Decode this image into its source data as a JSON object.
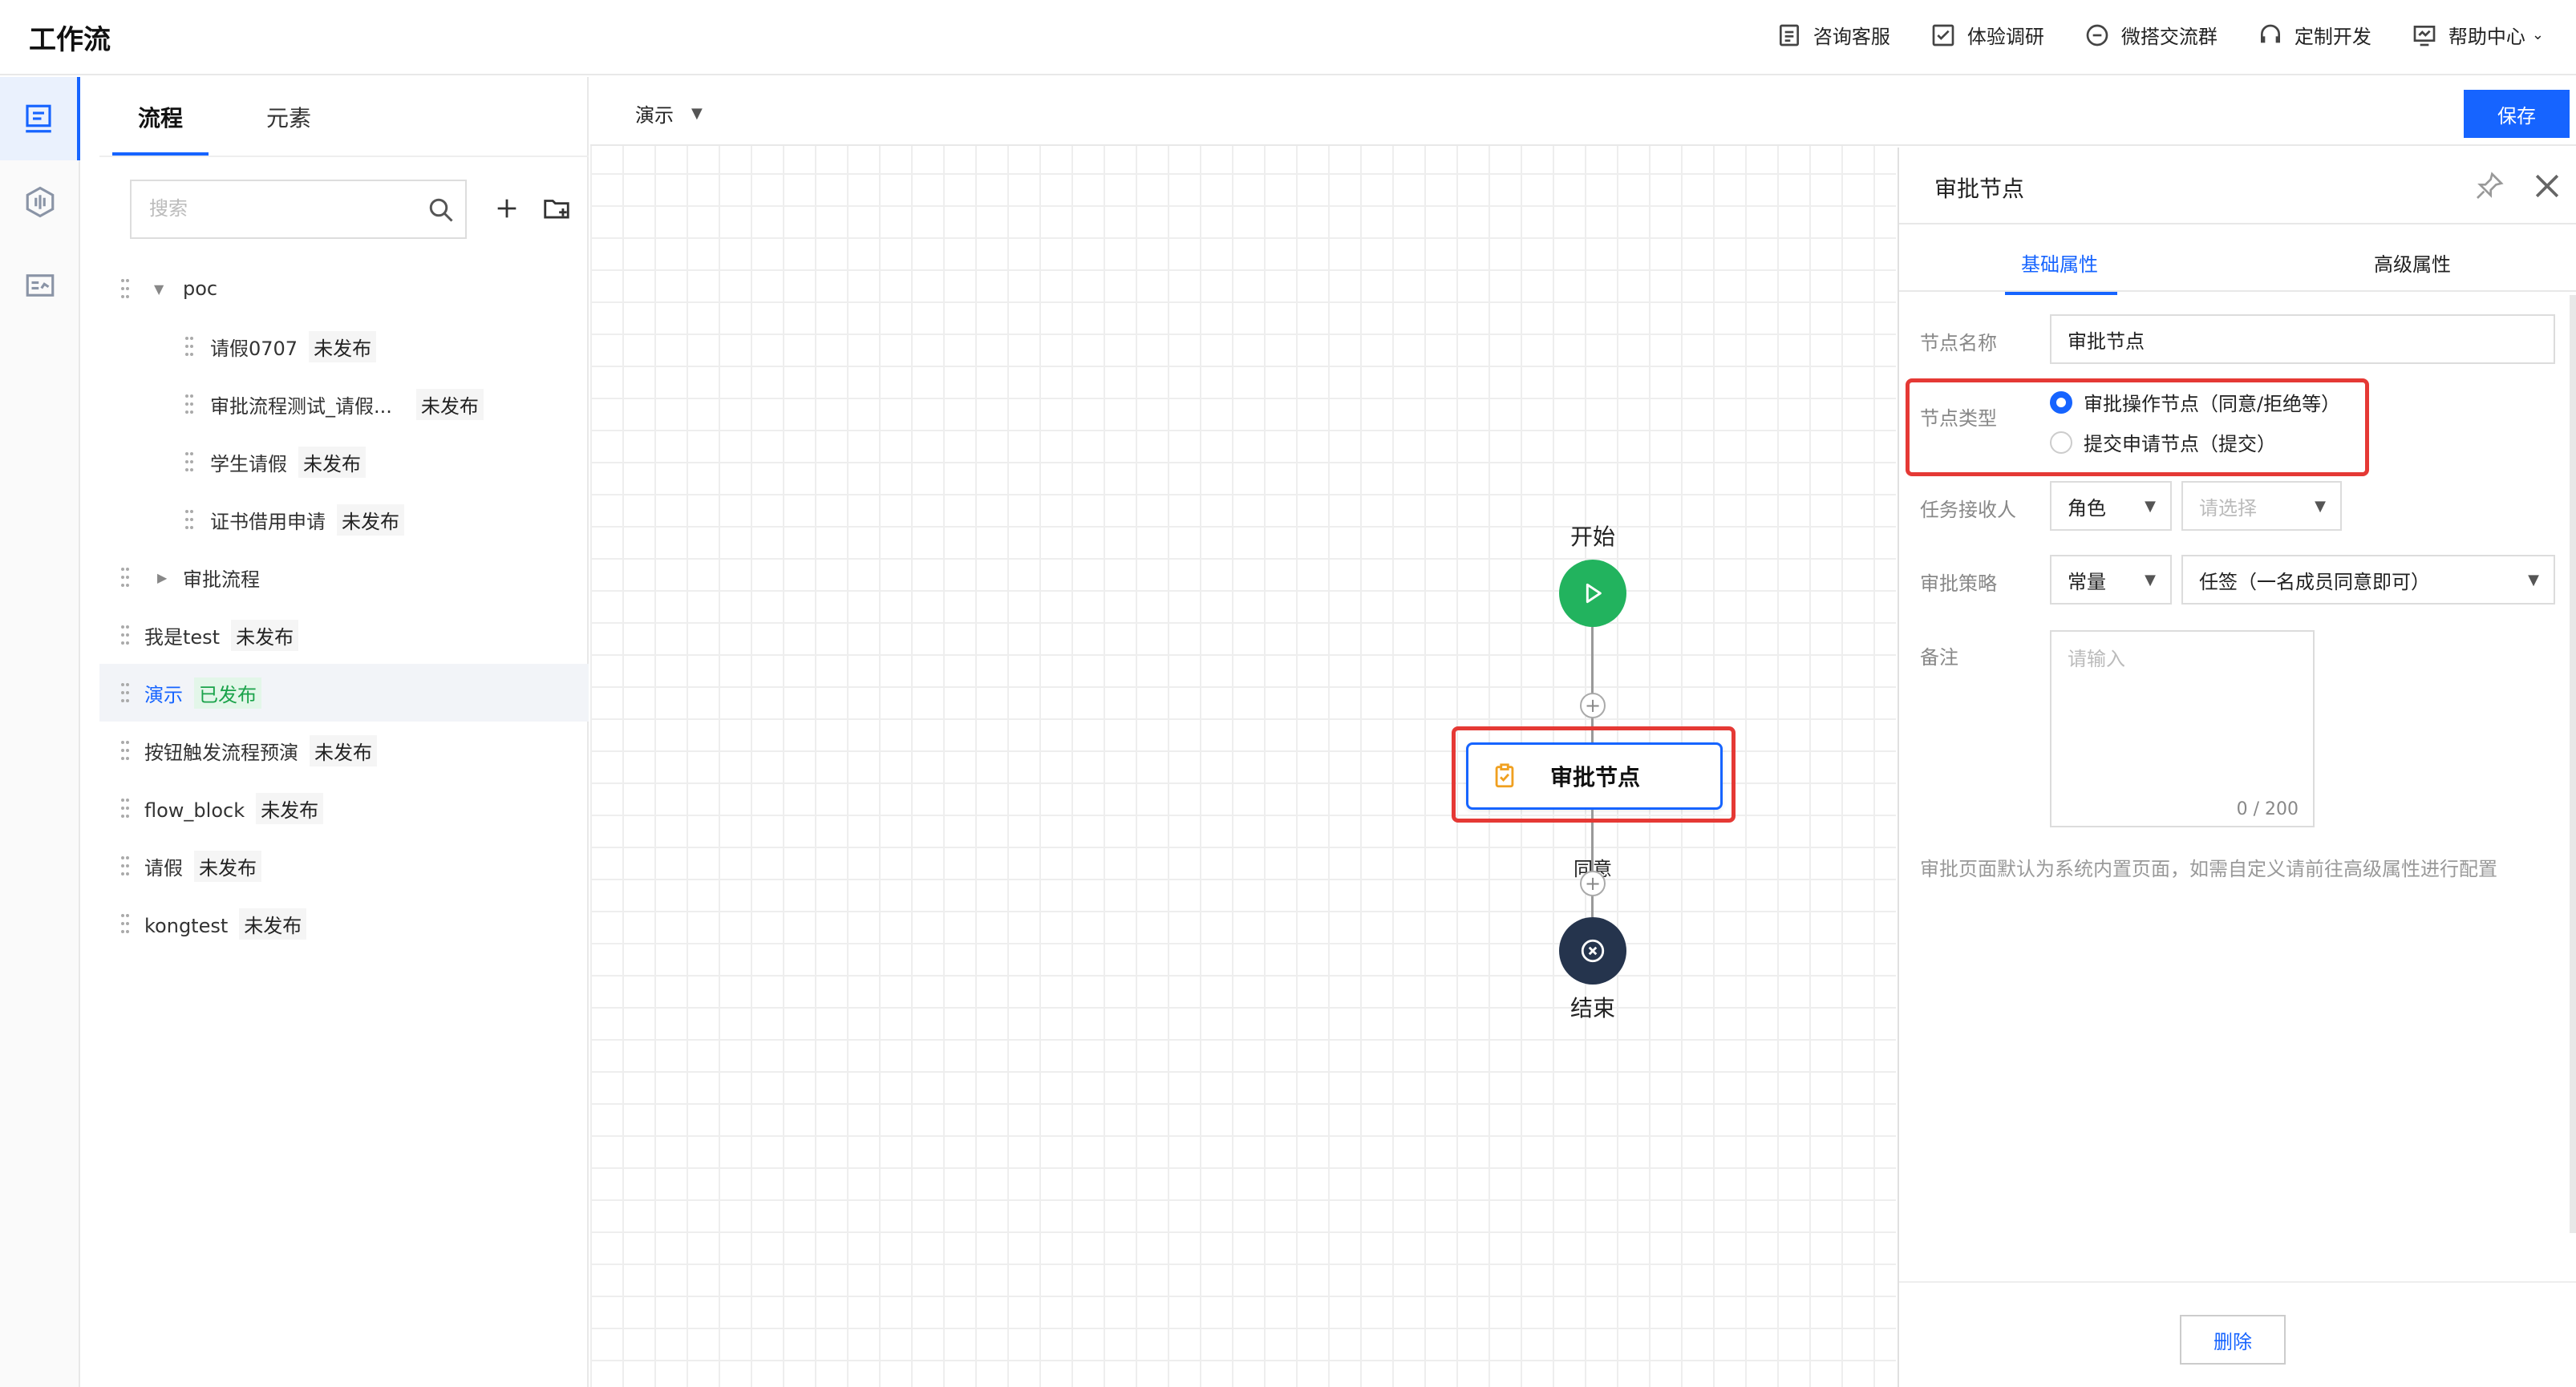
{
  "app": {
    "title": "工作流"
  },
  "top_nav": [
    {
      "label": "咨询客服",
      "icon": "clipboard-icon"
    },
    {
      "label": "体验调研",
      "icon": "checklist-icon"
    },
    {
      "label": "微搭交流群",
      "icon": "chat-icon"
    },
    {
      "label": "定制开发",
      "icon": "headset-icon"
    },
    {
      "label": "帮助中心",
      "icon": "monitor-help-icon"
    }
  ],
  "rail": [
    {
      "icon": "flow-doc-icon",
      "active": true
    },
    {
      "icon": "hexagon-icon",
      "active": false
    },
    {
      "icon": "form-icon",
      "active": false
    }
  ],
  "left_panel": {
    "tabs": [
      "流程",
      "元素"
    ],
    "active_tab": "流程",
    "search": {
      "placeholder": "搜索",
      "value": ""
    },
    "tree": [
      {
        "label": "poc",
        "level": 0,
        "type": "folder",
        "expanded": true,
        "badge": ""
      },
      {
        "label": "请假0707",
        "level": 1,
        "badge": "未发布"
      },
      {
        "label": "审批流程测试_请假...",
        "level": 1,
        "badge": "未发布"
      },
      {
        "label": "学生请假",
        "level": 1,
        "badge": "未发布"
      },
      {
        "label": "证书借用申请",
        "level": 1,
        "badge": "未发布"
      },
      {
        "label": "审批流程",
        "level": 0,
        "type": "folder",
        "expanded": false,
        "badge": ""
      },
      {
        "label": "我是test",
        "level": 0,
        "badge": "未发布"
      },
      {
        "label": "演示",
        "level": 0,
        "badge": "已发布",
        "selected": true
      },
      {
        "label": "按钮触发流程预演",
        "level": 0,
        "badge": "未发布"
      },
      {
        "label": "flow_block",
        "level": 0,
        "badge": "未发布"
      },
      {
        "label": "请假",
        "level": 0,
        "badge": "未发布"
      },
      {
        "label": "kongtest",
        "level": 0,
        "badge": "未发布"
      }
    ]
  },
  "canvas": {
    "flow_name": "演示",
    "save_label": "保存",
    "start_label": "开始",
    "approve_label": "审批节点",
    "edge_label": "同意",
    "end_label": "结束"
  },
  "props": {
    "title": "审批节点",
    "tabs": [
      "基础属性",
      "高级属性"
    ],
    "active_tab": "基础属性",
    "node_name_label": "节点名称",
    "node_name_value": "审批节点",
    "node_type_label": "节点类型",
    "node_type_options": [
      "审批操作节点（同意/拒绝等）",
      "提交申请节点（提交）"
    ],
    "node_type_selected": 0,
    "receiver_label": "任务接收人",
    "receiver_type": "角色",
    "receiver_placeholder": "请选择",
    "strategy_label": "审批策略",
    "strategy_type": "常量",
    "strategy_value": "任签（一名成员同意即可）",
    "remark_label": "备注",
    "remark_placeholder": "请输入",
    "remark_counter": "0 / 200",
    "hint": "审批页面默认为系统内置页面，如需自定义请前往高级属性进行配置",
    "delete_label": "删除"
  },
  "colors": {
    "accent": "#1664ff",
    "start_node": "#22b35e",
    "end_node": "#25344d",
    "published": "#1aa34a",
    "highlight_box": "#e53935"
  }
}
